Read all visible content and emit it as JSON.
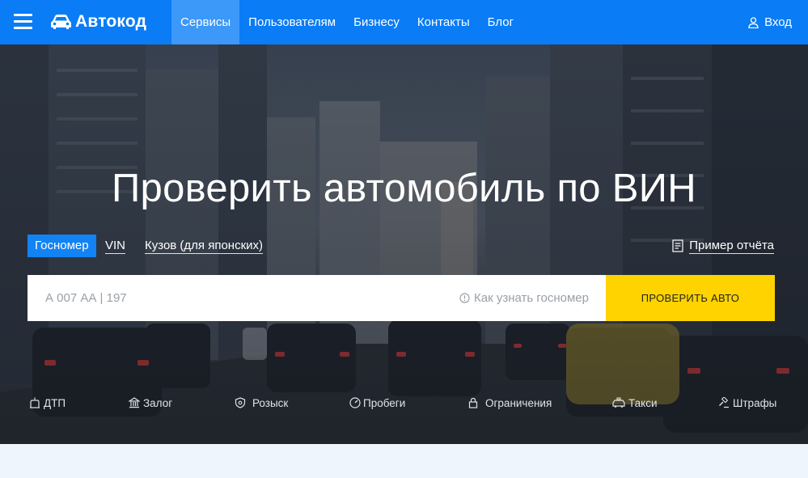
{
  "header": {
    "logo_text": "Автокод",
    "nav": [
      {
        "label": "Сервисы",
        "active": true
      },
      {
        "label": "Пользователям"
      },
      {
        "label": "Бизнесу"
      },
      {
        "label": "Контакты"
      },
      {
        "label": "Блог"
      }
    ],
    "login_label": "Вход"
  },
  "hero": {
    "title": "Проверить автомобиль по ВИН",
    "tabs": [
      {
        "label": "Госномер",
        "active": true
      },
      {
        "label": "VIN"
      },
      {
        "label": "Кузов (для японских)"
      }
    ],
    "sample_report_label": "Пример отчёта",
    "search": {
      "placeholder": "А 007 АА | 197",
      "help_text": "Как узнать госномер",
      "button_label": "ПРОВЕРИТЬ АВТО"
    },
    "services": [
      {
        "label": "ДТП",
        "icon": "car-crash-icon"
      },
      {
        "label": "Залог",
        "icon": "bank-icon"
      },
      {
        "label": "Розыск",
        "icon": "shield-icon"
      },
      {
        "label": "Пробеги",
        "icon": "speedometer-icon"
      },
      {
        "label": "Ограничения",
        "icon": "lock-icon"
      },
      {
        "label": "Такси",
        "icon": "taxi-icon"
      },
      {
        "label": "Штрафы",
        "icon": "gavel-icon"
      }
    ]
  },
  "colors": {
    "header_bg": "#0a7cf6",
    "active_nav_bg": "#3c98f9",
    "active_tab_bg": "#1183f5",
    "cta_button": "#ffd300",
    "page_bg": "#eef5fd"
  }
}
